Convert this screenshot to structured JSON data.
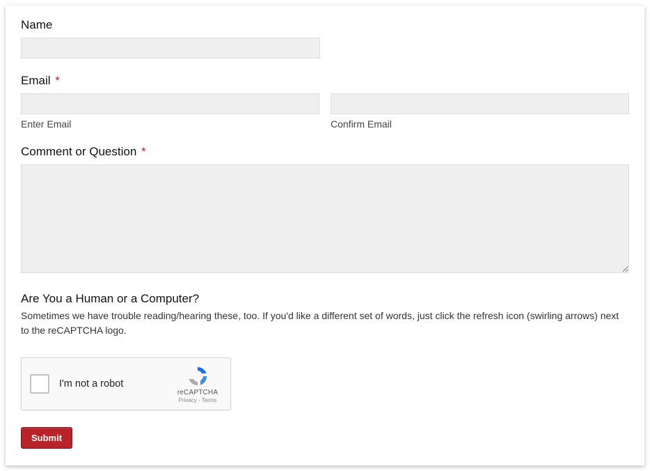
{
  "form": {
    "name": {
      "label": "Name",
      "value": ""
    },
    "email": {
      "label": "Email",
      "required_mark": "*",
      "enter_value": "",
      "enter_sublabel": "Enter Email",
      "confirm_value": "",
      "confirm_sublabel": "Confirm Email"
    },
    "comment": {
      "label": "Comment or Question",
      "required_mark": "*",
      "value": ""
    },
    "captcha": {
      "heading": "Are You a Human or a Computer?",
      "help": "Sometimes we have trouble reading/hearing these, too. If you'd like a different set of words, just click the refresh icon (swirling arrows) next to the reCAPTCHA logo.",
      "checkbox_label": "I'm not a robot",
      "brand": "reCAPTCHA",
      "links": "Privacy - Terms"
    },
    "submit_label": "Submit"
  }
}
